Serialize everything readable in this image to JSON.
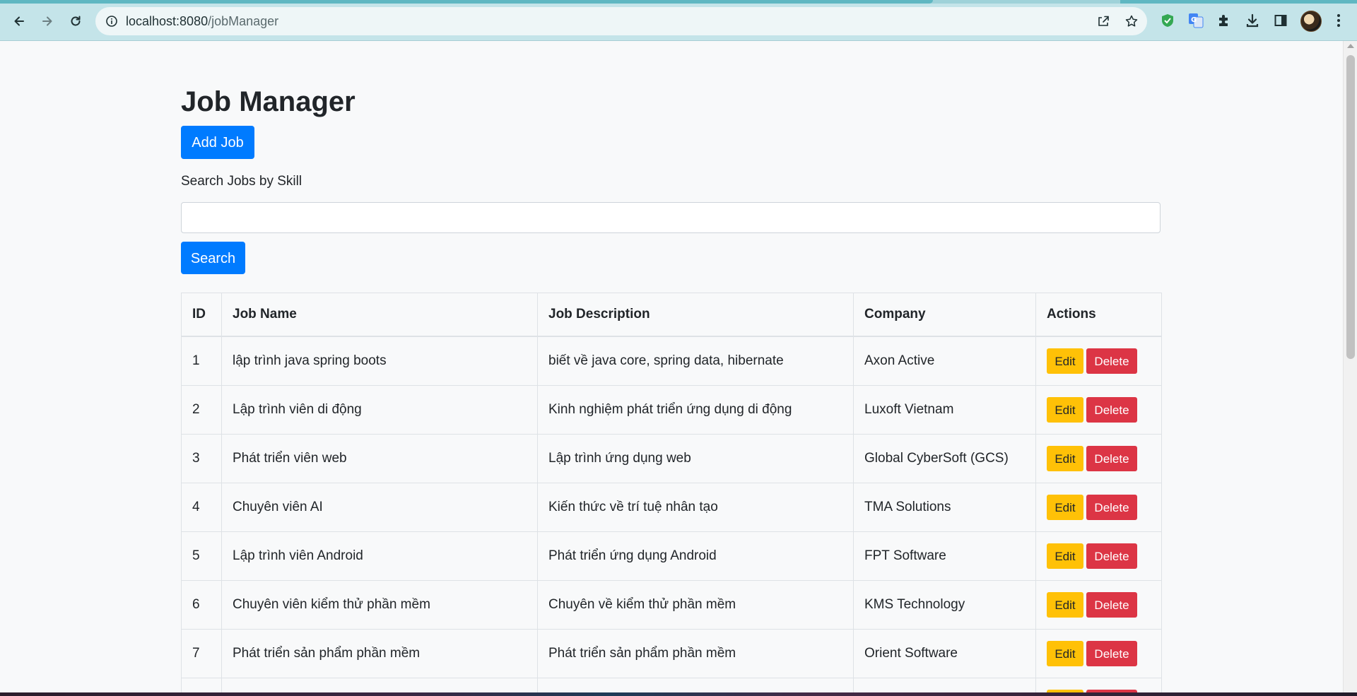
{
  "browser": {
    "url_host": "localhost:8080",
    "url_path": "/jobManager"
  },
  "page": {
    "title": "Job Manager",
    "add_button": "Add Job",
    "search_label": "Search Jobs by Skill",
    "search_value": "",
    "search_button": "Search"
  },
  "table": {
    "headers": [
      "ID",
      "Job Name",
      "Job Description",
      "Company",
      "Actions"
    ],
    "edit_label": "Edit",
    "delete_label": "Delete",
    "rows": [
      {
        "id": "1",
        "name": "lập trình java spring boots",
        "description": "biết về java core, spring data, hibernate",
        "company": "Axon Active"
      },
      {
        "id": "2",
        "name": "Lập trình viên di động",
        "description": "Kinh nghiệm phát triển ứng dụng di động",
        "company": "Luxoft Vietnam"
      },
      {
        "id": "3",
        "name": "Phát triển viên web",
        "description": "Lập trình ứng dụng web",
        "company": "Global CyberSoft (GCS)"
      },
      {
        "id": "4",
        "name": "Chuyên viên AI",
        "description": "Kiến thức về trí tuệ nhân tạo",
        "company": "TMA Solutions"
      },
      {
        "id": "5",
        "name": "Lập trình viên Android",
        "description": "Phát triển ứng dụng Android",
        "company": "FPT Software"
      },
      {
        "id": "6",
        "name": "Chuyên viên kiểm thử phần mềm",
        "description": "Chuyên về kiểm thử phần mềm",
        "company": "KMS Technology"
      },
      {
        "id": "7",
        "name": "Phát triển sản phẩm phần mềm",
        "description": "Phát triển sản phẩm phần mềm",
        "company": "Orient Software"
      },
      {
        "id": "",
        "name": "",
        "description": "",
        "company": ""
      }
    ]
  },
  "colors": {
    "primary": "#007bff",
    "edit": "#ffc107",
    "delete": "#dc3545",
    "chrome": "#c4e4e9"
  },
  "icons": [
    "back-icon",
    "forward-icon",
    "reload-icon",
    "info-icon",
    "share-icon",
    "star-icon",
    "shield-extension-icon",
    "translate-extension-icon",
    "puzzle-extensions-icon",
    "download-icon",
    "side-panel-icon",
    "profile-avatar",
    "more-menu-icon"
  ]
}
